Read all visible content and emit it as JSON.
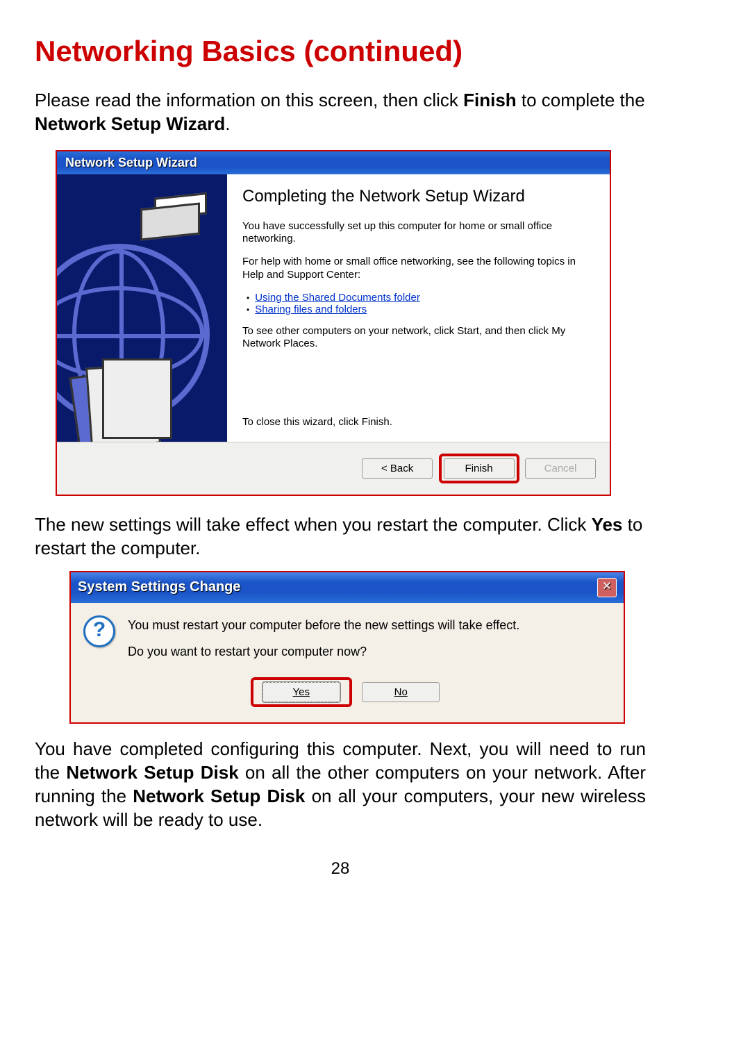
{
  "page_title": "Networking Basics (continued)",
  "intro": {
    "pre": "Please read the information on this screen, then click ",
    "bold1": "Finish",
    "mid": " to complete the ",
    "bold2": "Network Setup Wizard",
    "post": "."
  },
  "wizard": {
    "titlebar": "Network Setup Wizard",
    "heading": "Completing the Network Setup Wizard",
    "para1": "You have successfully set up this computer for home or small office networking.",
    "para2": "For help with home or small office networking, see the following topics in Help and Support Center:",
    "link1": "Using the Shared Documents folder",
    "link2": "Sharing files and folders",
    "para3": "To see other computers on your network, click Start, and then click My Network Places.",
    "close_text": "To close this wizard, click Finish.",
    "btn_back": "< Back",
    "btn_finish": "Finish",
    "btn_cancel": "Cancel"
  },
  "mid_text": {
    "pre": "The new settings will take effect when you restart the computer. Click ",
    "bold": "Yes",
    "post": " to restart the computer."
  },
  "alert": {
    "titlebar": "System Settings Change",
    "line1": "You must restart your computer before the new settings will take effect.",
    "line2": "Do you want to restart your computer now?",
    "btn_yes": "Yes",
    "btn_no": "No"
  },
  "outro": {
    "t1": "You have completed configuring this computer. Next, you will need to run the ",
    "b1": "Network Setup Disk",
    "t2": " on all the other computers on your network. After running the ",
    "b2": "Network Setup Disk",
    "t3": " on all your computers, your new wireless network will be ready to use."
  },
  "page_number": "28"
}
